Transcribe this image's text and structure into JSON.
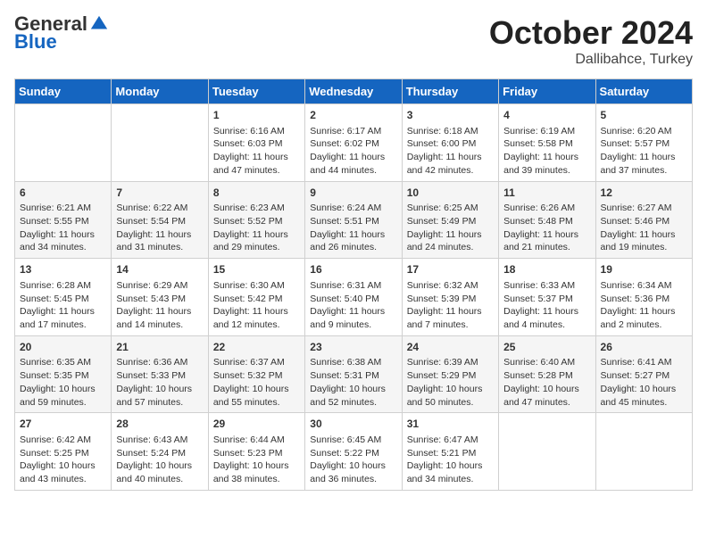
{
  "logo": {
    "general": "General",
    "blue": "Blue"
  },
  "header": {
    "month_year": "October 2024",
    "location": "Dallibahce, Turkey"
  },
  "weekdays": [
    "Sunday",
    "Monday",
    "Tuesday",
    "Wednesday",
    "Thursday",
    "Friday",
    "Saturday"
  ],
  "weeks": [
    [
      {
        "day": "",
        "info": ""
      },
      {
        "day": "",
        "info": ""
      },
      {
        "day": "1",
        "sunrise": "6:16 AM",
        "sunset": "6:03 PM",
        "daylight": "11 hours and 47 minutes."
      },
      {
        "day": "2",
        "sunrise": "6:17 AM",
        "sunset": "6:02 PM",
        "daylight": "11 hours and 44 minutes."
      },
      {
        "day": "3",
        "sunrise": "6:18 AM",
        "sunset": "6:00 PM",
        "daylight": "11 hours and 42 minutes."
      },
      {
        "day": "4",
        "sunrise": "6:19 AM",
        "sunset": "5:58 PM",
        "daylight": "11 hours and 39 minutes."
      },
      {
        "day": "5",
        "sunrise": "6:20 AM",
        "sunset": "5:57 PM",
        "daylight": "11 hours and 37 minutes."
      }
    ],
    [
      {
        "day": "6",
        "sunrise": "6:21 AM",
        "sunset": "5:55 PM",
        "daylight": "11 hours and 34 minutes."
      },
      {
        "day": "7",
        "sunrise": "6:22 AM",
        "sunset": "5:54 PM",
        "daylight": "11 hours and 31 minutes."
      },
      {
        "day": "8",
        "sunrise": "6:23 AM",
        "sunset": "5:52 PM",
        "daylight": "11 hours and 29 minutes."
      },
      {
        "day": "9",
        "sunrise": "6:24 AM",
        "sunset": "5:51 PM",
        "daylight": "11 hours and 26 minutes."
      },
      {
        "day": "10",
        "sunrise": "6:25 AM",
        "sunset": "5:49 PM",
        "daylight": "11 hours and 24 minutes."
      },
      {
        "day": "11",
        "sunrise": "6:26 AM",
        "sunset": "5:48 PM",
        "daylight": "11 hours and 21 minutes."
      },
      {
        "day": "12",
        "sunrise": "6:27 AM",
        "sunset": "5:46 PM",
        "daylight": "11 hours and 19 minutes."
      }
    ],
    [
      {
        "day": "13",
        "sunrise": "6:28 AM",
        "sunset": "5:45 PM",
        "daylight": "11 hours and 17 minutes."
      },
      {
        "day": "14",
        "sunrise": "6:29 AM",
        "sunset": "5:43 PM",
        "daylight": "11 hours and 14 minutes."
      },
      {
        "day": "15",
        "sunrise": "6:30 AM",
        "sunset": "5:42 PM",
        "daylight": "11 hours and 12 minutes."
      },
      {
        "day": "16",
        "sunrise": "6:31 AM",
        "sunset": "5:40 PM",
        "daylight": "11 hours and 9 minutes."
      },
      {
        "day": "17",
        "sunrise": "6:32 AM",
        "sunset": "5:39 PM",
        "daylight": "11 hours and 7 minutes."
      },
      {
        "day": "18",
        "sunrise": "6:33 AM",
        "sunset": "5:37 PM",
        "daylight": "11 hours and 4 minutes."
      },
      {
        "day": "19",
        "sunrise": "6:34 AM",
        "sunset": "5:36 PM",
        "daylight": "11 hours and 2 minutes."
      }
    ],
    [
      {
        "day": "20",
        "sunrise": "6:35 AM",
        "sunset": "5:35 PM",
        "daylight": "10 hours and 59 minutes."
      },
      {
        "day": "21",
        "sunrise": "6:36 AM",
        "sunset": "5:33 PM",
        "daylight": "10 hours and 57 minutes."
      },
      {
        "day": "22",
        "sunrise": "6:37 AM",
        "sunset": "5:32 PM",
        "daylight": "10 hours and 55 minutes."
      },
      {
        "day": "23",
        "sunrise": "6:38 AM",
        "sunset": "5:31 PM",
        "daylight": "10 hours and 52 minutes."
      },
      {
        "day": "24",
        "sunrise": "6:39 AM",
        "sunset": "5:29 PM",
        "daylight": "10 hours and 50 minutes."
      },
      {
        "day": "25",
        "sunrise": "6:40 AM",
        "sunset": "5:28 PM",
        "daylight": "10 hours and 47 minutes."
      },
      {
        "day": "26",
        "sunrise": "6:41 AM",
        "sunset": "5:27 PM",
        "daylight": "10 hours and 45 minutes."
      }
    ],
    [
      {
        "day": "27",
        "sunrise": "6:42 AM",
        "sunset": "5:25 PM",
        "daylight": "10 hours and 43 minutes."
      },
      {
        "day": "28",
        "sunrise": "6:43 AM",
        "sunset": "5:24 PM",
        "daylight": "10 hours and 40 minutes."
      },
      {
        "day": "29",
        "sunrise": "6:44 AM",
        "sunset": "5:23 PM",
        "daylight": "10 hours and 38 minutes."
      },
      {
        "day": "30",
        "sunrise": "6:45 AM",
        "sunset": "5:22 PM",
        "daylight": "10 hours and 36 minutes."
      },
      {
        "day": "31",
        "sunrise": "6:47 AM",
        "sunset": "5:21 PM",
        "daylight": "10 hours and 34 minutes."
      },
      {
        "day": "",
        "info": ""
      },
      {
        "day": "",
        "info": ""
      }
    ]
  ],
  "labels": {
    "sunrise": "Sunrise:",
    "sunset": "Sunset:",
    "daylight": "Daylight:"
  }
}
